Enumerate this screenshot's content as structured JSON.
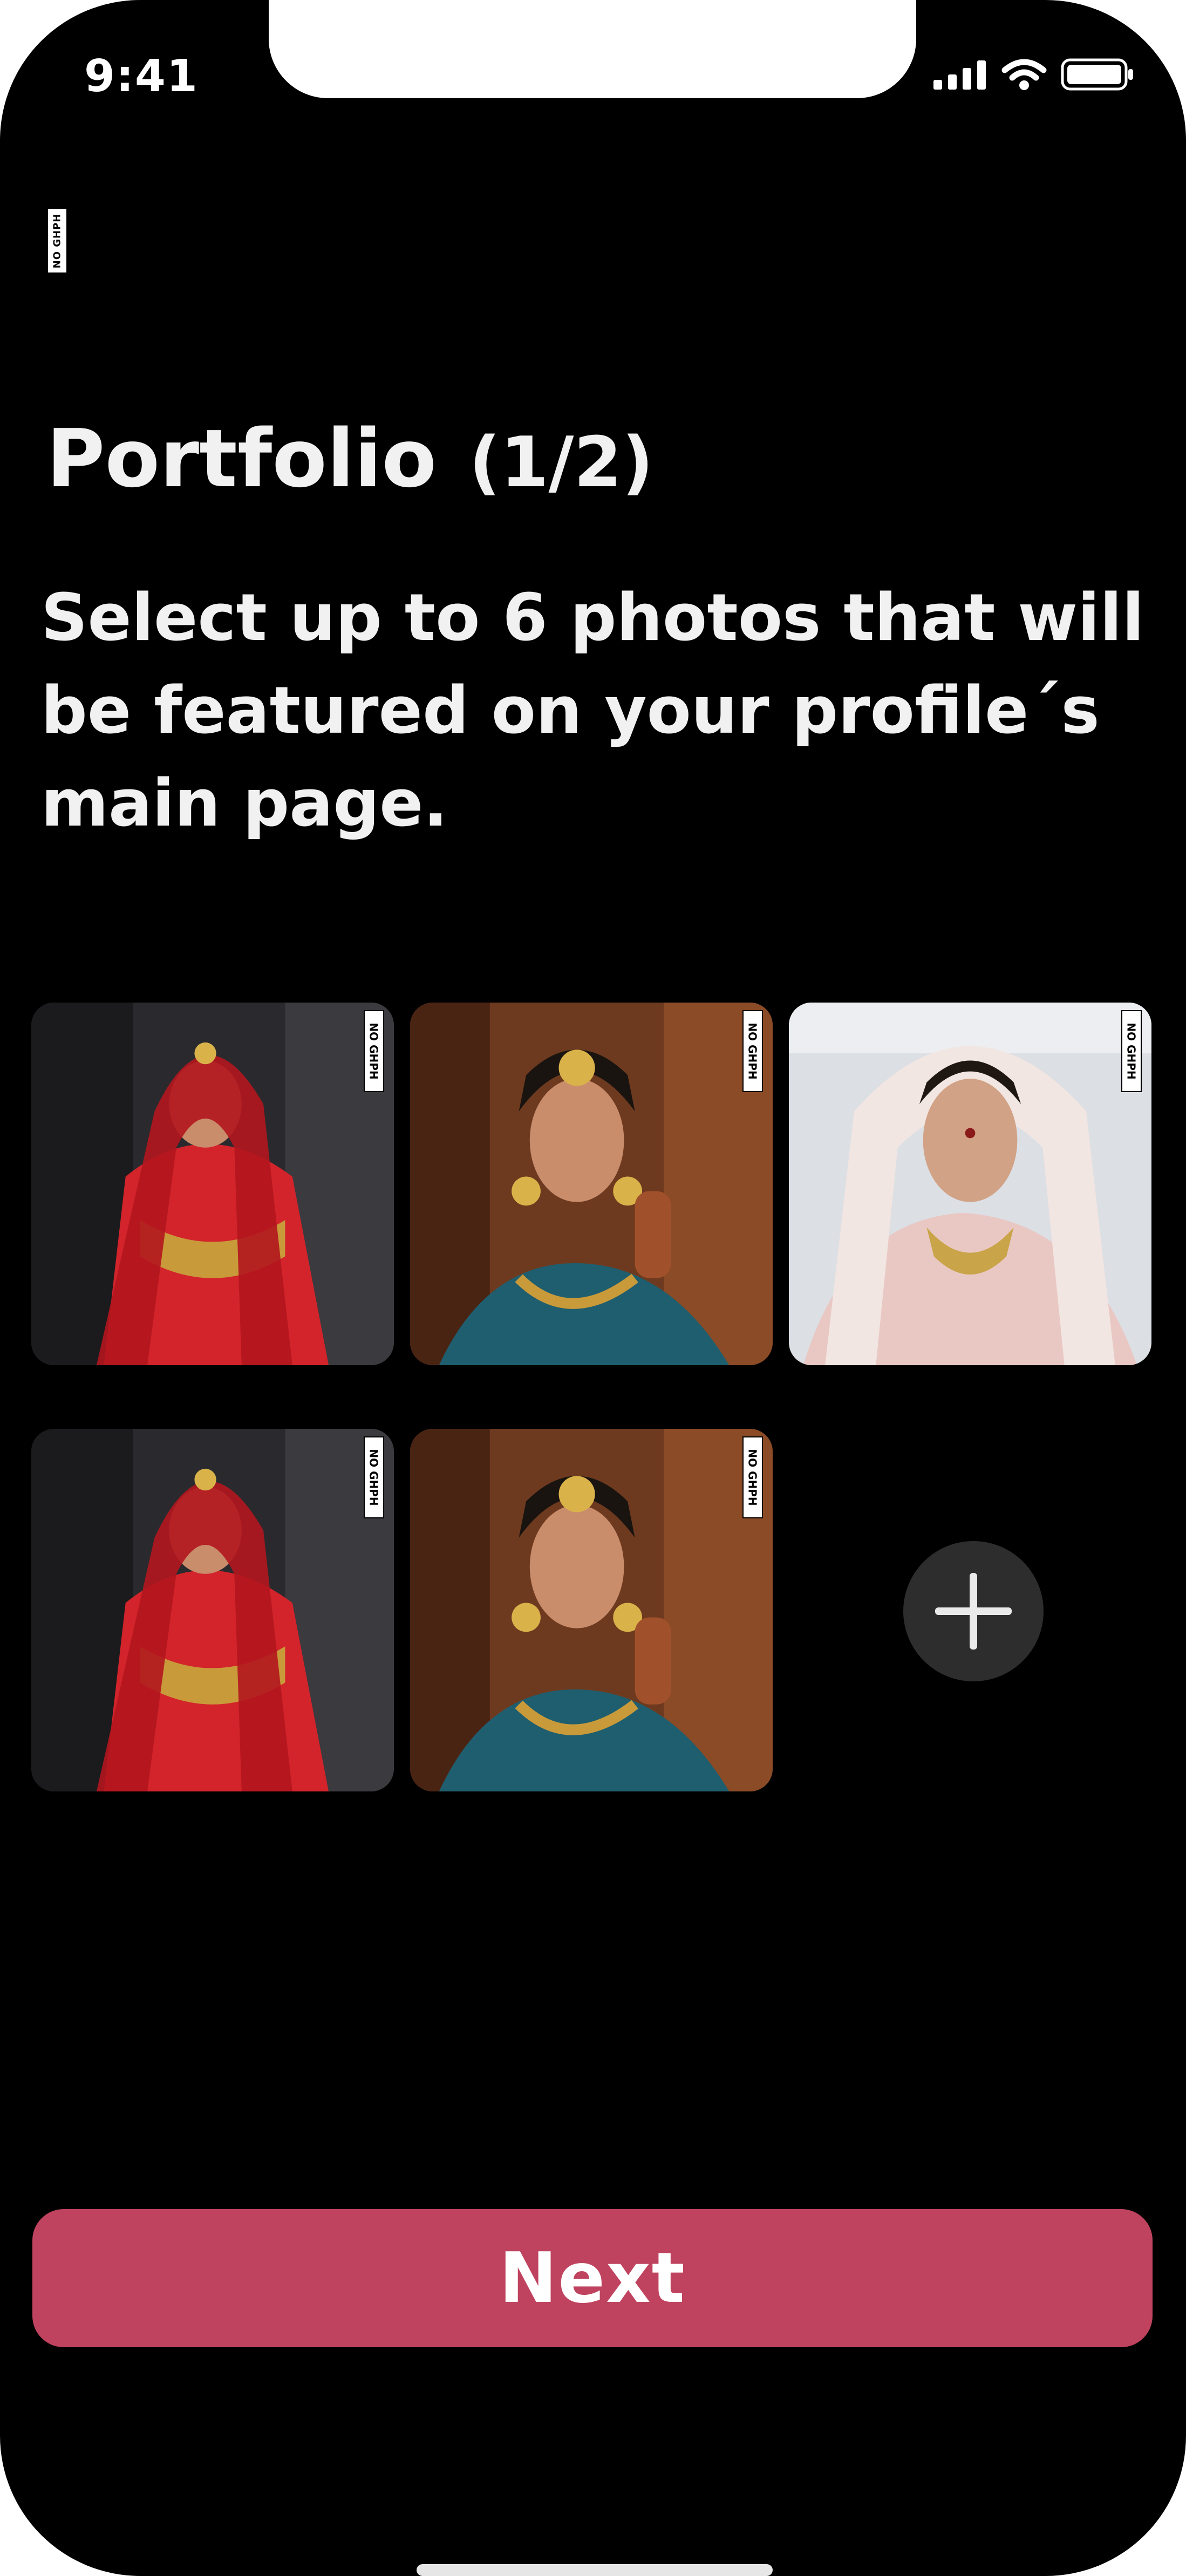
{
  "status_bar": {
    "time": "9:41"
  },
  "brand": {
    "logo_text": "NO GHPH"
  },
  "header": {
    "title": "Portfolio",
    "page_indicator": "(1/2)",
    "description": "Select up to 6 photos that will be featured on your profile´s main page."
  },
  "photos": [
    {
      "badge": "NO GHPH",
      "style": "red-lehenga"
    },
    {
      "badge": "NO GHPH",
      "style": "teal-gold-jewelry"
    },
    {
      "badge": "NO GHPH",
      "style": "pastel-bridal"
    },
    {
      "badge": "NO GHPH",
      "style": "red-lehenga"
    },
    {
      "badge": "NO GHPH",
      "style": "teal-gold-jewelry"
    }
  ],
  "add_photo": {
    "icon": "plus-icon"
  },
  "actions": {
    "next_label": "Next"
  },
  "colors": {
    "background": "#000000",
    "accent": "#bf435f",
    "add_button": "#2d2d2d",
    "text": "#f1f1f1"
  }
}
